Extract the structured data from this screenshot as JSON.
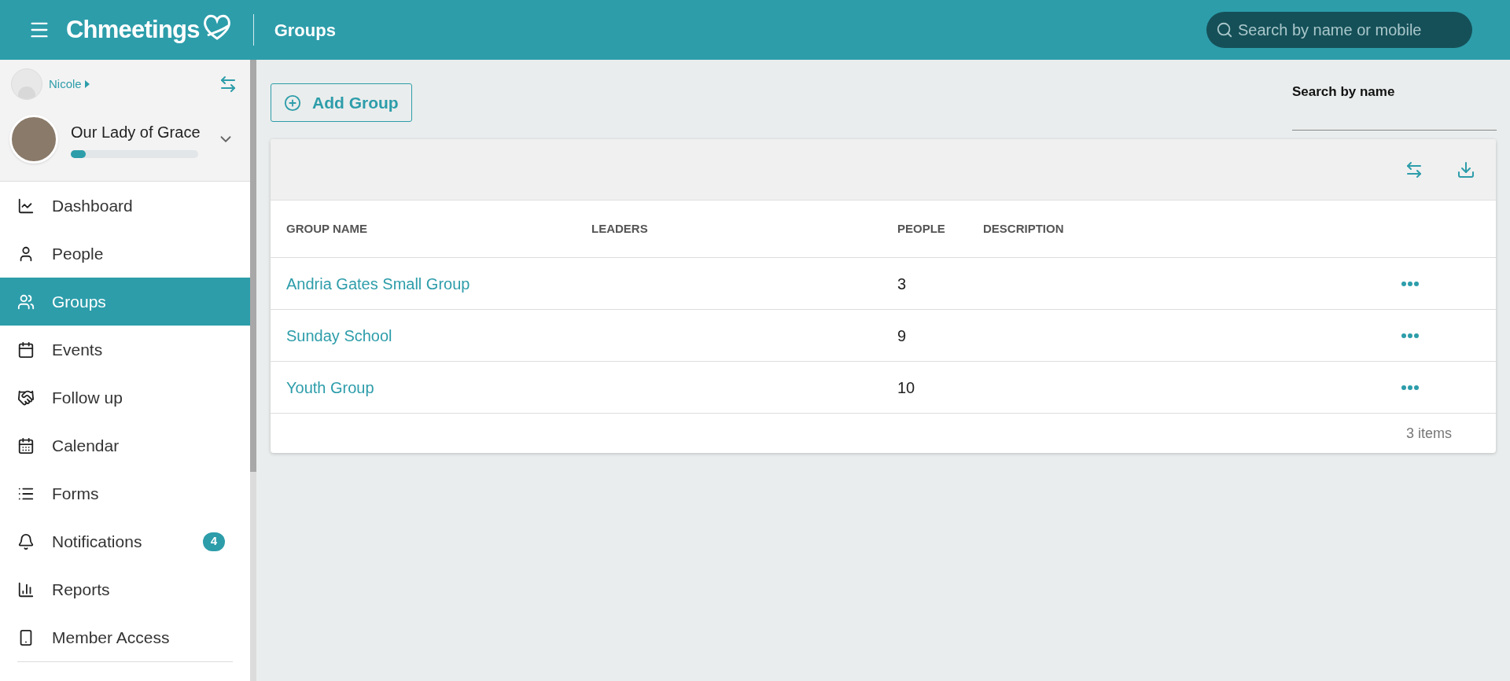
{
  "header": {
    "logo": "Chmeetings",
    "page_title": "Groups",
    "search": {
      "placeholder": "Search by name or mobile"
    }
  },
  "sidebar": {
    "user": {
      "name": "Nicole"
    },
    "organization": {
      "name": "Our Lady of Grace",
      "level": 0.12
    },
    "items": [
      {
        "label": "Dashboard",
        "selected": false
      },
      {
        "label": "People",
        "selected": false
      },
      {
        "label": "Groups",
        "selected": true
      },
      {
        "label": "Events",
        "selected": false
      },
      {
        "label": "Follow up",
        "selected": false
      },
      {
        "label": "Calendar",
        "selected": false
      },
      {
        "label": "Forms",
        "selected": false
      },
      {
        "label": "Notifications",
        "selected": false,
        "badge": "4"
      },
      {
        "label": "Reports",
        "selected": false
      },
      {
        "label": "Member Access",
        "selected": false
      }
    ]
  },
  "toolbar": {
    "add_button": "Add Group",
    "name_filter": {
      "label": "Search by name"
    }
  },
  "table": {
    "columns": [
      "GROUP NAME",
      "LEADERS",
      "PEOPLE",
      "DESCRIPTION"
    ],
    "rows": [
      {
        "name": "Andria Gates Small Group",
        "people": "3"
      },
      {
        "name": "Sunday School",
        "people": "9"
      },
      {
        "name": "Youth Group",
        "people": "10"
      }
    ],
    "footer": "3 items"
  }
}
